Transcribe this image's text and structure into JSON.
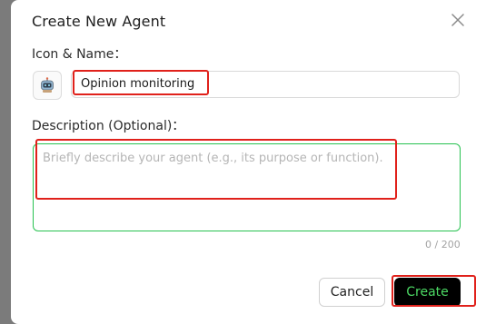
{
  "dialog": {
    "title": "Create New Agent",
    "name_label": "Icon & Name：",
    "name_value": "Opinion monitoring",
    "description_label": "Description (Optional)：",
    "description_placeholder": "Briefly describe your agent (e.g., its purpose or function).",
    "description_value": "",
    "char_counter": "0 / 200",
    "cancel_label": "Cancel",
    "create_label": "Create"
  },
  "icons": {
    "close": "close-icon",
    "agent_avatar": "robot-icon"
  },
  "colors": {
    "accent_green": "#27c250",
    "create_button_bg": "#000000",
    "create_button_text": "#4cd964",
    "annotation_red": "#e0211b"
  }
}
